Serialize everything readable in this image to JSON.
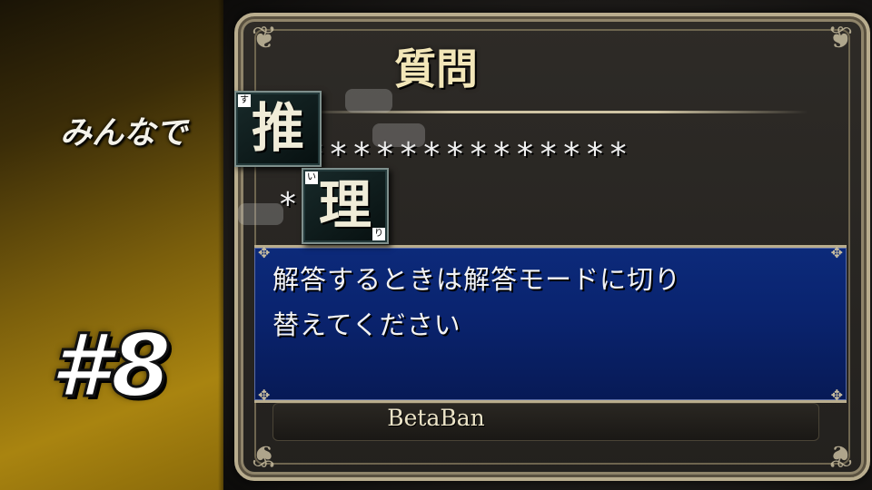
{
  "left_panel": {
    "episode_label": "#8"
  },
  "logo": {
    "prefix": "みんなで",
    "kanji_1": "推",
    "kanji_1_furigana": "す",
    "kanji_2": "理",
    "kanji_2_furigana_top": "い",
    "kanji_2_furigana_bottom": "り"
  },
  "dialog": {
    "title": "質問",
    "masked_line_1": "**************",
    "masked_line_2": "*",
    "message_line_1": "解答するときは解答モードに切り",
    "message_line_2": "替えてください",
    "footer": "BetaBan"
  },
  "colors": {
    "gold_panel": "#a98410",
    "message_box_blue": "#0a2470",
    "frame_border": "#b9ad8e",
    "title_text": "#f2e6b8"
  },
  "icons": [
    "frame-ornament-icon",
    "corner-flourish-icon"
  ]
}
